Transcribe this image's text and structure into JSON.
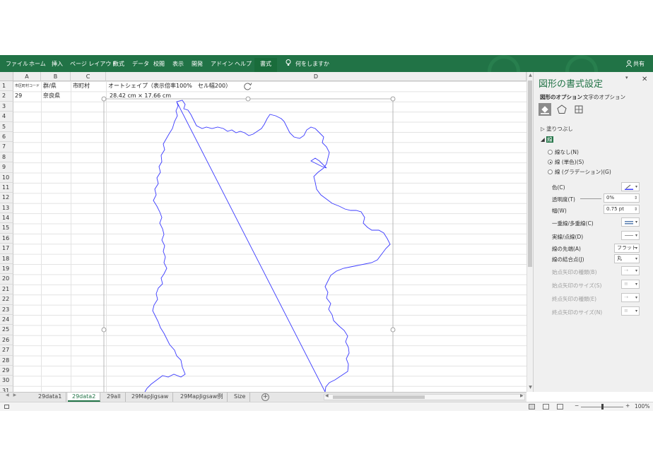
{
  "ribbon": {
    "tabs": [
      "ファイル",
      "ホーム",
      "挿入",
      "ページ レイアウト",
      "数式",
      "データ",
      "校閲",
      "表示",
      "開発",
      "アドイン",
      "ヘルプ"
    ],
    "active_tab": "書式",
    "tell_me": "何をしますか",
    "share": "共有",
    "color": "#217346"
  },
  "grid": {
    "columns": [
      "A",
      "B",
      "C",
      "D"
    ],
    "rows": [
      "1",
      "2",
      "3",
      "4",
      "5",
      "6",
      "7",
      "8",
      "9",
      "10",
      "11",
      "12",
      "13",
      "14",
      "15",
      "16",
      "17",
      "18",
      "19",
      "20",
      "21",
      "22",
      "23",
      "24",
      "25",
      "26",
      "27",
      "28",
      "29",
      "30",
      "31"
    ],
    "cells": {
      "A1": "市区町村コード",
      "B1": "群/県",
      "C1": "市町村",
      "D1": "オートシェイプ（表示倍率100%　セル幅200）",
      "A2": "29",
      "B2": "奈良県",
      "D2": "28.42 cm × 17.66 cm"
    },
    "outline_color": "#3a3aff"
  },
  "pane": {
    "title": "図形の書式設定",
    "tabs": [
      "図形のオプション",
      "文字のオプション"
    ],
    "sections": {
      "fill": "塗りつぶし",
      "line": "線"
    },
    "line_options": [
      "線なし(N)",
      "線 (単色)(S)",
      "線 (グラデーション)(G)"
    ],
    "selected_option": 1,
    "properties": [
      {
        "label": "色(C)",
        "value": "",
        "disabled": false
      },
      {
        "label": "透明度(T)",
        "value": "0%",
        "disabled": false
      },
      {
        "label": "幅(W)",
        "value": "0.75 pt",
        "disabled": false
      },
      {
        "label": "一重線/多重線(C)",
        "value": "",
        "disabled": false
      },
      {
        "label": "実線/点線(D)",
        "value": "",
        "disabled": false
      },
      {
        "label": "線の先端(A)",
        "value": "フラット",
        "disabled": false
      },
      {
        "label": "線の結合点(J)",
        "value": "丸",
        "disabled": false
      },
      {
        "label": "始点矢印の種類(B)",
        "value": "",
        "disabled": true
      },
      {
        "label": "始点矢印のサイズ(S)",
        "value": "",
        "disabled": true
      },
      {
        "label": "終点矢印の種類(E)",
        "value": "",
        "disabled": true
      },
      {
        "label": "終点矢印のサイズ(N)",
        "value": "",
        "disabled": true
      }
    ]
  },
  "sheets": {
    "tabs": [
      "29data1",
      "29data2",
      "29all",
      "29MapJigsaw",
      "29MapJigsaw例",
      "Size"
    ],
    "active": "29data2"
  },
  "status": {
    "zoom": "100%"
  }
}
